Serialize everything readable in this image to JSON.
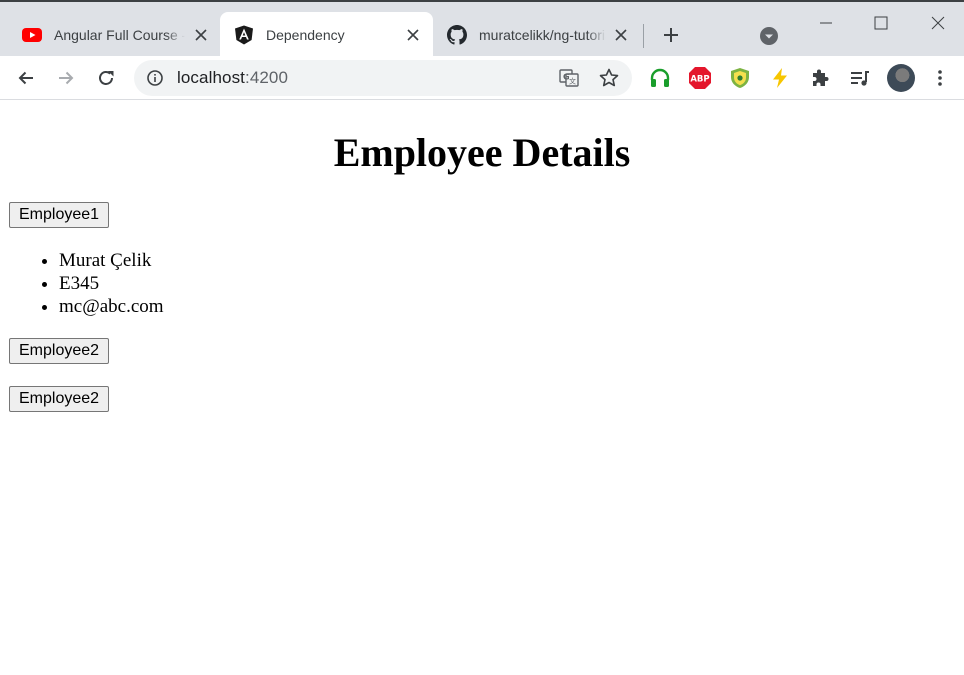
{
  "browser": {
    "tabs": [
      {
        "title": "Angular Full Course - L",
        "favicon": "youtube-icon",
        "active": false
      },
      {
        "title": "Dependency",
        "favicon": "angular-icon",
        "active": true
      },
      {
        "title": "muratcelikk/ng-tutoria",
        "favicon": "github-icon",
        "active": false
      }
    ],
    "address": {
      "host": "localhost",
      "port": ":4200"
    }
  },
  "page": {
    "heading": "Employee Details",
    "buttons": {
      "employee1": "Employee1",
      "employee2_first": "Employee2",
      "employee2_second": "Employee2"
    },
    "employee_list": [
      "Murat Çelik",
      "E345",
      "mc@abc.com"
    ]
  },
  "colors": {
    "tabstrip": "#dee1e6",
    "omnibox": "#f1f3f4",
    "youtube": "#ff0000",
    "abp": "#e4162c",
    "headphones": "#1a9e2c",
    "bolt": "#f7c600"
  }
}
